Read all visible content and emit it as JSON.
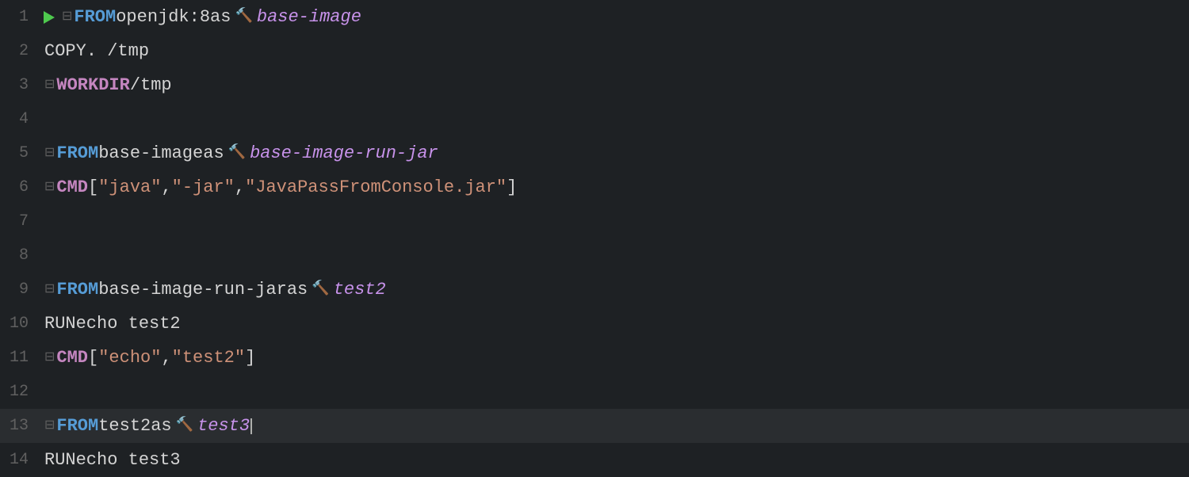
{
  "editor": {
    "background": "#1e2124",
    "lines": [
      {
        "number": 1,
        "tokens": [
          {
            "type": "run-icon",
            "value": "▶"
          },
          {
            "type": "fold",
            "value": "⊟"
          },
          {
            "type": "keyword-from",
            "value": "FROM"
          },
          {
            "type": "plain",
            "value": " openjdk:8 "
          },
          {
            "type": "plain",
            "value": "as"
          },
          {
            "type": "hammer",
            "value": "🔨"
          },
          {
            "type": "italic-purple",
            "value": " base-image"
          }
        ]
      },
      {
        "number": 2,
        "tokens": [
          {
            "type": "plain-indent",
            "value": "    "
          },
          {
            "type": "keyword-copy",
            "value": "COPY"
          },
          {
            "type": "plain",
            "value": " . /tmp"
          }
        ]
      },
      {
        "number": 3,
        "tokens": [
          {
            "type": "fold",
            "value": "⊟"
          },
          {
            "type": "keyword-workdir",
            "value": "WORKDIR"
          },
          {
            "type": "plain",
            "value": " /tmp"
          }
        ]
      },
      {
        "number": 4,
        "tokens": []
      },
      {
        "number": 5,
        "tokens": [
          {
            "type": "fold-cursor",
            "value": "⊟"
          },
          {
            "type": "keyword-from",
            "value": "FROM"
          },
          {
            "type": "plain",
            "value": " base-image "
          },
          {
            "type": "plain",
            "value": "as"
          },
          {
            "type": "hammer",
            "value": "🔨"
          },
          {
            "type": "italic-purple",
            "value": " base-image-run-jar"
          }
        ]
      },
      {
        "number": 6,
        "tokens": [
          {
            "type": "fold",
            "value": "⊟"
          },
          {
            "type": "keyword-cmd",
            "value": "CMD"
          },
          {
            "type": "plain",
            "value": " ["
          },
          {
            "type": "string",
            "value": "\"java\""
          },
          {
            "type": "plain",
            "value": ", "
          },
          {
            "type": "string",
            "value": "\"-jar\""
          },
          {
            "type": "plain",
            "value": ", "
          },
          {
            "type": "string",
            "value": "\"JavaPassFromConsole.jar\""
          },
          {
            "type": "plain",
            "value": "]"
          }
        ]
      },
      {
        "number": 7,
        "tokens": []
      },
      {
        "number": 8,
        "tokens": []
      },
      {
        "number": 9,
        "tokens": [
          {
            "type": "fold",
            "value": "⊟"
          },
          {
            "type": "keyword-from",
            "value": "FROM"
          },
          {
            "type": "plain",
            "value": " base-image-run-jar "
          },
          {
            "type": "plain",
            "value": "as"
          },
          {
            "type": "hammer",
            "value": "🔨"
          },
          {
            "type": "italic-purple",
            "value": " test2"
          }
        ]
      },
      {
        "number": 10,
        "tokens": [
          {
            "type": "plain-indent",
            "value": "    "
          },
          {
            "type": "keyword-run",
            "value": "RUN"
          },
          {
            "type": "plain",
            "value": " echo test2"
          }
        ]
      },
      {
        "number": 11,
        "tokens": [
          {
            "type": "fold",
            "value": "⊟"
          },
          {
            "type": "keyword-cmd",
            "value": "CMD"
          },
          {
            "type": "plain",
            "value": " [ "
          },
          {
            "type": "string",
            "value": "\"echo\""
          },
          {
            "type": "plain",
            "value": ", "
          },
          {
            "type": "string",
            "value": "\"test2\""
          },
          {
            "type": "plain",
            "value": "]"
          }
        ]
      },
      {
        "number": 12,
        "tokens": []
      },
      {
        "number": 13,
        "tokens": [
          {
            "type": "fold",
            "value": "⊟"
          },
          {
            "type": "keyword-from",
            "value": "FROM"
          },
          {
            "type": "plain",
            "value": " test2 "
          },
          {
            "type": "plain",
            "value": "as"
          },
          {
            "type": "hammer",
            "value": "🔨"
          },
          {
            "type": "italic-purple",
            "value": " test3"
          },
          {
            "type": "cursor",
            "value": ""
          }
        ],
        "active": true
      },
      {
        "number": 14,
        "tokens": [
          {
            "type": "plain-indent",
            "value": "    "
          },
          {
            "type": "keyword-run",
            "value": "RUN"
          },
          {
            "type": "plain",
            "value": " echo test3"
          }
        ]
      }
    ]
  }
}
